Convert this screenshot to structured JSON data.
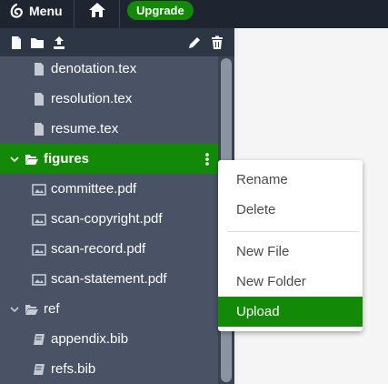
{
  "topbar": {
    "menu_label": "Menu",
    "upgrade_label": "Upgrade"
  },
  "toolbar": {
    "icons": [
      "new-file-icon",
      "new-folder-icon",
      "upload-icon",
      "rename-icon",
      "delete-icon"
    ]
  },
  "filetree": {
    "items": [
      {
        "label": "denotation.tex",
        "icon": "file-icon",
        "depth": 1
      },
      {
        "label": "resolution.tex",
        "icon": "file-icon",
        "depth": 1
      },
      {
        "label": "resume.tex",
        "icon": "file-icon",
        "depth": 1
      },
      {
        "label": "figures",
        "icon": "folder-open-icon",
        "depth": 0,
        "selected": true,
        "expanded": true
      },
      {
        "label": "committee.pdf",
        "icon": "image-icon",
        "depth": 1
      },
      {
        "label": "scan-copyright.pdf",
        "icon": "image-icon",
        "depth": 1
      },
      {
        "label": "scan-record.pdf",
        "icon": "image-icon",
        "depth": 1
      },
      {
        "label": "scan-statement.pdf",
        "icon": "image-icon",
        "depth": 1
      },
      {
        "label": "ref",
        "icon": "folder-open-icon",
        "depth": 0,
        "expanded": true
      },
      {
        "label": "appendix.bib",
        "icon": "bib-icon",
        "depth": 1
      },
      {
        "label": "refs.bib",
        "icon": "bib-icon",
        "depth": 1
      }
    ]
  },
  "context_menu": {
    "items": [
      {
        "label": "Rename"
      },
      {
        "label": "Delete"
      },
      {
        "label": "New File"
      },
      {
        "label": "New Folder"
      },
      {
        "label": "Upload",
        "active": true
      }
    ]
  },
  "colors": {
    "topbar_bg": "#1e2530",
    "sidebar_bg": "#495365",
    "toolbar_bg": "#2c3645",
    "accent_green": "#138a07",
    "editor_bg": "#f5f5f5"
  }
}
